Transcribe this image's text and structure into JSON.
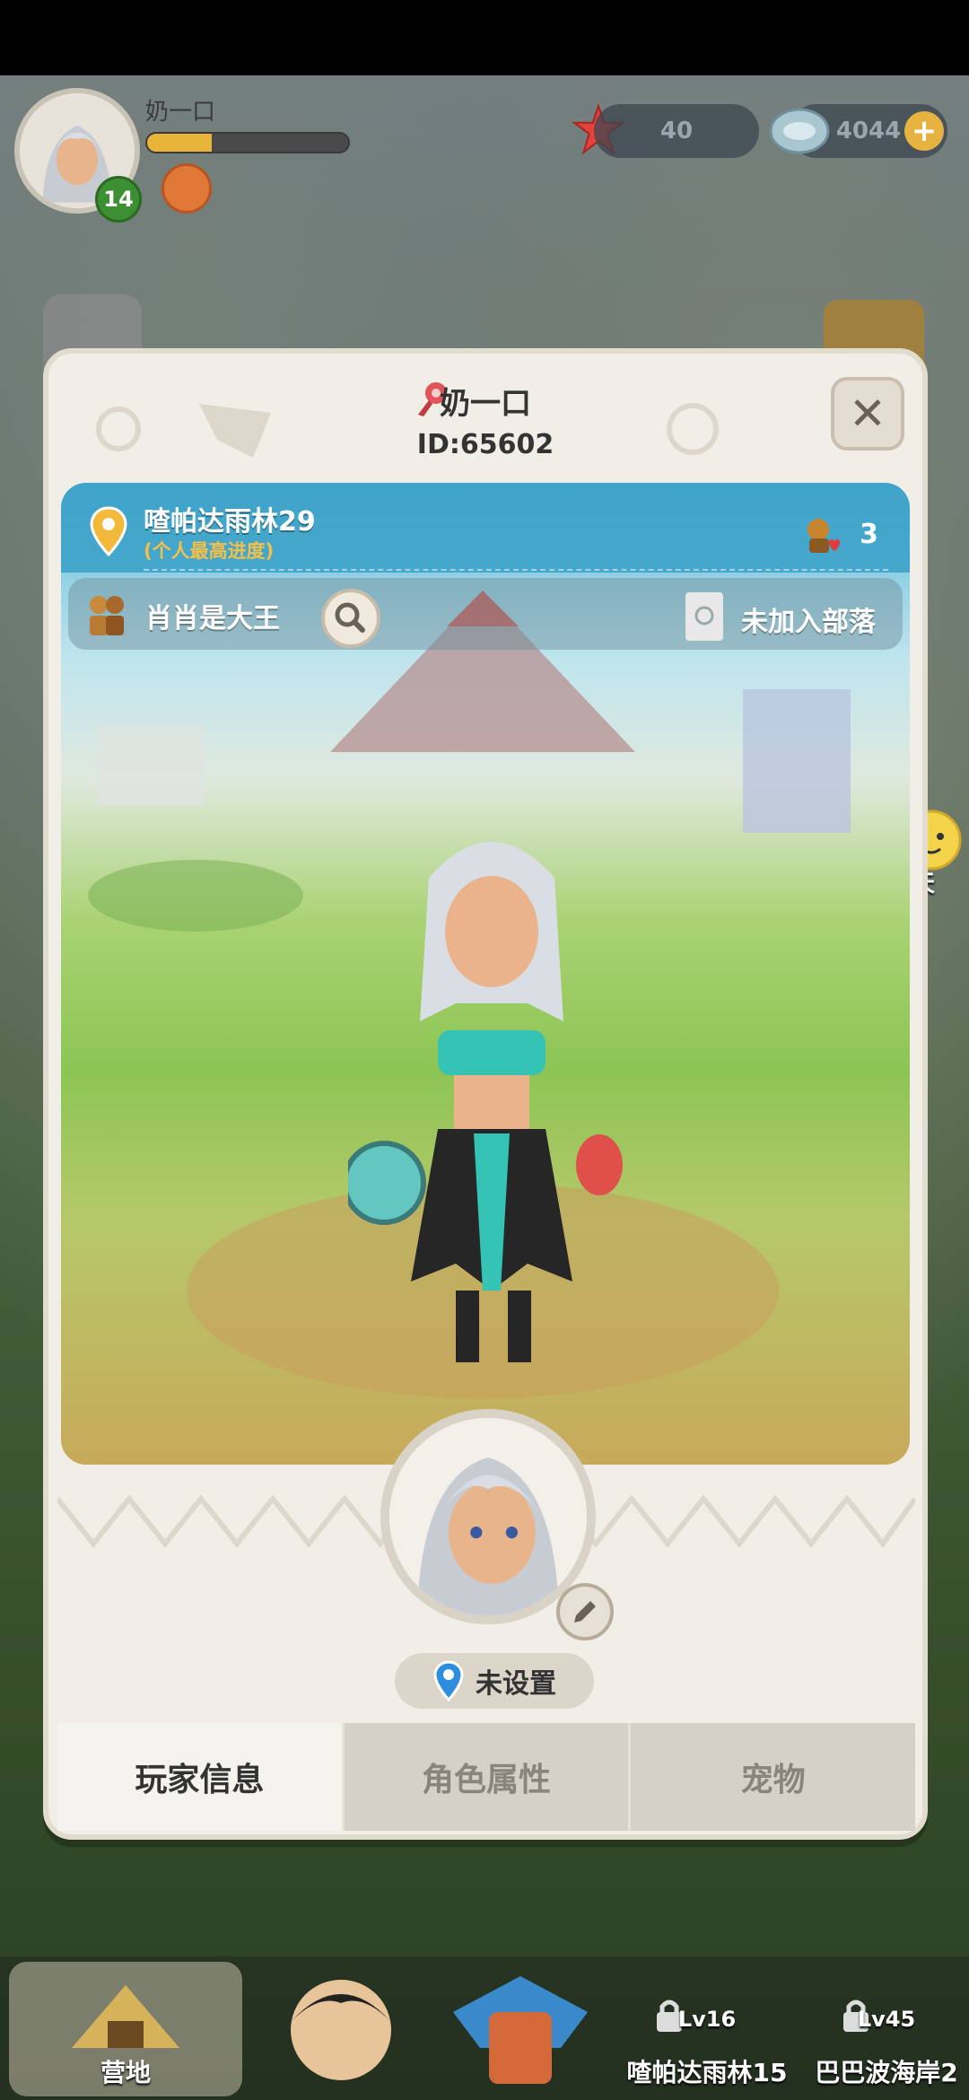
{
  "hud": {
    "player_name": "奶一口",
    "level": "14",
    "xp_fraction": 0.32,
    "starfish_count": "40",
    "shell_count": "4044",
    "plus_label": "+"
  },
  "side": {
    "chat_label": "聊天"
  },
  "profile": {
    "name": "奶一口",
    "id_text": "ID:65602",
    "close_label": "✕",
    "best_stage": "喳帕达雨林29",
    "best_stage_note": "(个人最高进度)",
    "likes": "3",
    "friend_name": "肖肖是大王",
    "tribe_status": "未加入部落",
    "location": "未设置"
  },
  "tabs": [
    "玩家信息",
    "角色属性",
    "宠物"
  ],
  "bottom_nav": {
    "home": "营地",
    "stage1_level": "Lv16",
    "stage1_name": "喳帕达雨林15",
    "stage2_level": "Lv45",
    "stage2_name": "巴巴波海岸2"
  },
  "colors": {
    "accent_teal": "#3aa0c8",
    "gold": "#f3c04a",
    "panel_bg": "#f1eee7"
  }
}
